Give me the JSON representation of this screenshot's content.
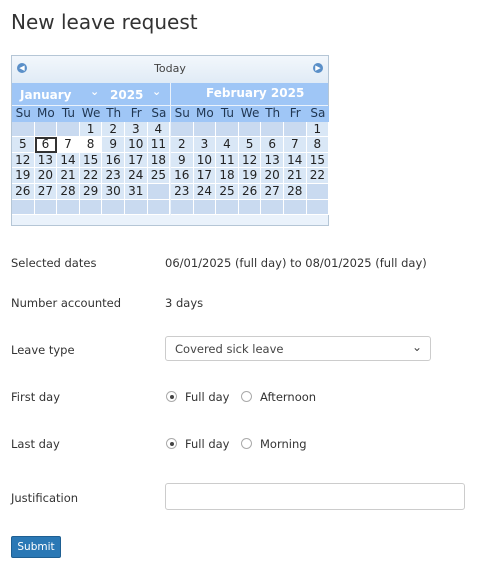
{
  "page": {
    "title": "New leave request"
  },
  "calendar": {
    "today_label": "Today",
    "prev_icon": "prev-month-icon",
    "next_icon": "next-month-icon",
    "month1": {
      "name": "January",
      "year": "2025"
    },
    "month2": {
      "name": "February 2025"
    },
    "weekdays": [
      "Su",
      "Mo",
      "Tu",
      "We",
      "Th",
      "Fr",
      "Sa"
    ],
    "jan_days": [
      [
        "",
        "",
        "",
        "1",
        "2",
        "3",
        "4"
      ],
      [
        "5",
        "6",
        "7",
        "8",
        "9",
        "10",
        "11"
      ],
      [
        "12",
        "13",
        "14",
        "15",
        "16",
        "17",
        "18"
      ],
      [
        "19",
        "20",
        "21",
        "22",
        "23",
        "24",
        "25"
      ],
      [
        "26",
        "27",
        "28",
        "29",
        "30",
        "31",
        ""
      ],
      [
        "",
        "",
        "",
        "",
        "",
        "",
        ""
      ]
    ],
    "feb_days": [
      [
        "",
        "",
        "",
        "",
        "",
        "",
        "1"
      ],
      [
        "2",
        "3",
        "4",
        "5",
        "6",
        "7",
        "8"
      ],
      [
        "9",
        "10",
        "11",
        "12",
        "13",
        "14",
        "15"
      ],
      [
        "16",
        "17",
        "18",
        "19",
        "20",
        "21",
        "22"
      ],
      [
        "23",
        "24",
        "25",
        "26",
        "27",
        "28",
        ""
      ],
      [
        "",
        "",
        "",
        "",
        "",
        "",
        ""
      ]
    ],
    "selected": [
      "6",
      "7",
      "8"
    ],
    "outlined": "6"
  },
  "form": {
    "selected_dates": {
      "label": "Selected dates",
      "value": "06/01/2025 (full day) to 08/01/2025 (full day)"
    },
    "number_accounted": {
      "label": "Number accounted",
      "value": "3 days"
    },
    "leave_type": {
      "label": "Leave type",
      "value": "Covered sick leave"
    },
    "first_day": {
      "label": "First day",
      "option1": "Full day",
      "option2": "Afternoon"
    },
    "last_day": {
      "label": "Last day",
      "option1": "Full day",
      "option2": "Morning"
    },
    "justification": {
      "label": "Justification",
      "value": ""
    },
    "submit_label": "Submit"
  }
}
